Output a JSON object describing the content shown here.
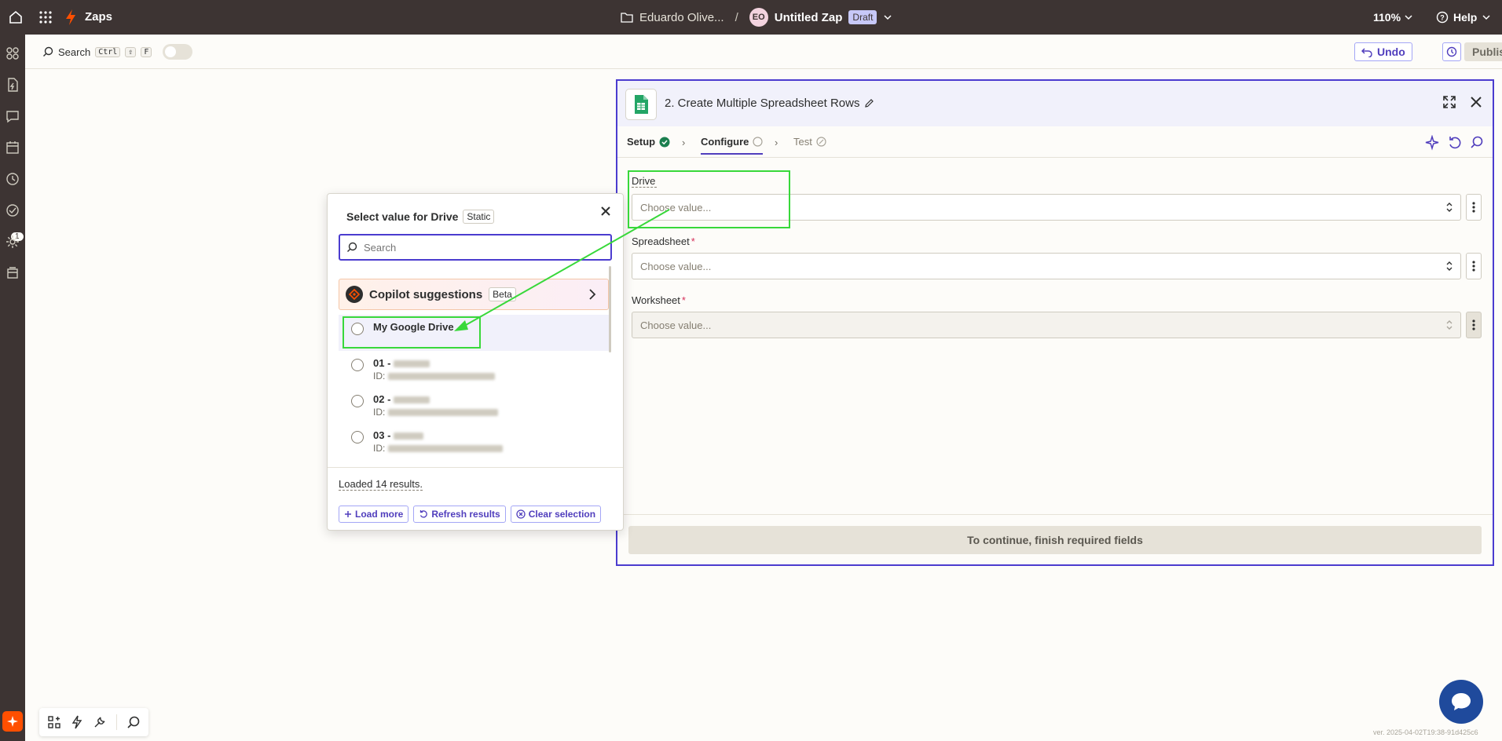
{
  "topbar": {
    "app_name": "Zaps",
    "folder": "Eduardo Olive...",
    "separator": "/",
    "avatar_initials": "EO",
    "zap_name": "Untitled Zap",
    "status": "Draft",
    "zoom": "110%",
    "help": "Help"
  },
  "rail": {
    "notification_count": "1"
  },
  "toolbar": {
    "search_label": "Search",
    "shortcut_ctrl": "Ctrl",
    "shortcut_shift": "⇧",
    "shortcut_key": "F",
    "undo": "Undo",
    "publish": "Publish"
  },
  "panel": {
    "title": "2. Create Multiple Spreadsheet Rows",
    "tabs": [
      {
        "label": "Setup"
      },
      {
        "label": "Configure"
      },
      {
        "label": "Test"
      }
    ],
    "fields": [
      {
        "label": "Drive",
        "required": "",
        "placeholder": "Choose value..."
      },
      {
        "label": "Spreadsheet",
        "required": "*",
        "placeholder": "Choose value..."
      },
      {
        "label": "Worksheet",
        "required": "*",
        "placeholder": "Choose value..."
      }
    ],
    "continue": "To continue, finish required fields"
  },
  "popover": {
    "title": "Select value for Drive",
    "badge": "Static",
    "search_placeholder": "Search",
    "copilot_label": "Copilot suggestions",
    "copilot_badge": "Beta",
    "options": [
      {
        "name": "My Google Drive",
        "id_label": ""
      },
      {
        "name": "01 -",
        "id_label": "ID:"
      },
      {
        "name": "02 -",
        "id_label": "ID:"
      },
      {
        "name": "03 -",
        "id_label": "ID:"
      }
    ],
    "loaded_text": "Loaded 14 results.",
    "load_more": "Load more",
    "refresh": "Refresh results",
    "clear": "Clear selection"
  },
  "version": "ver. 2025-04-02T19:38-91d425c6",
  "colors": {
    "accent": "#4b3ccf",
    "topbar": "#3d3433",
    "brand_orange": "#ff4f00",
    "annotation": "#38d83a"
  }
}
